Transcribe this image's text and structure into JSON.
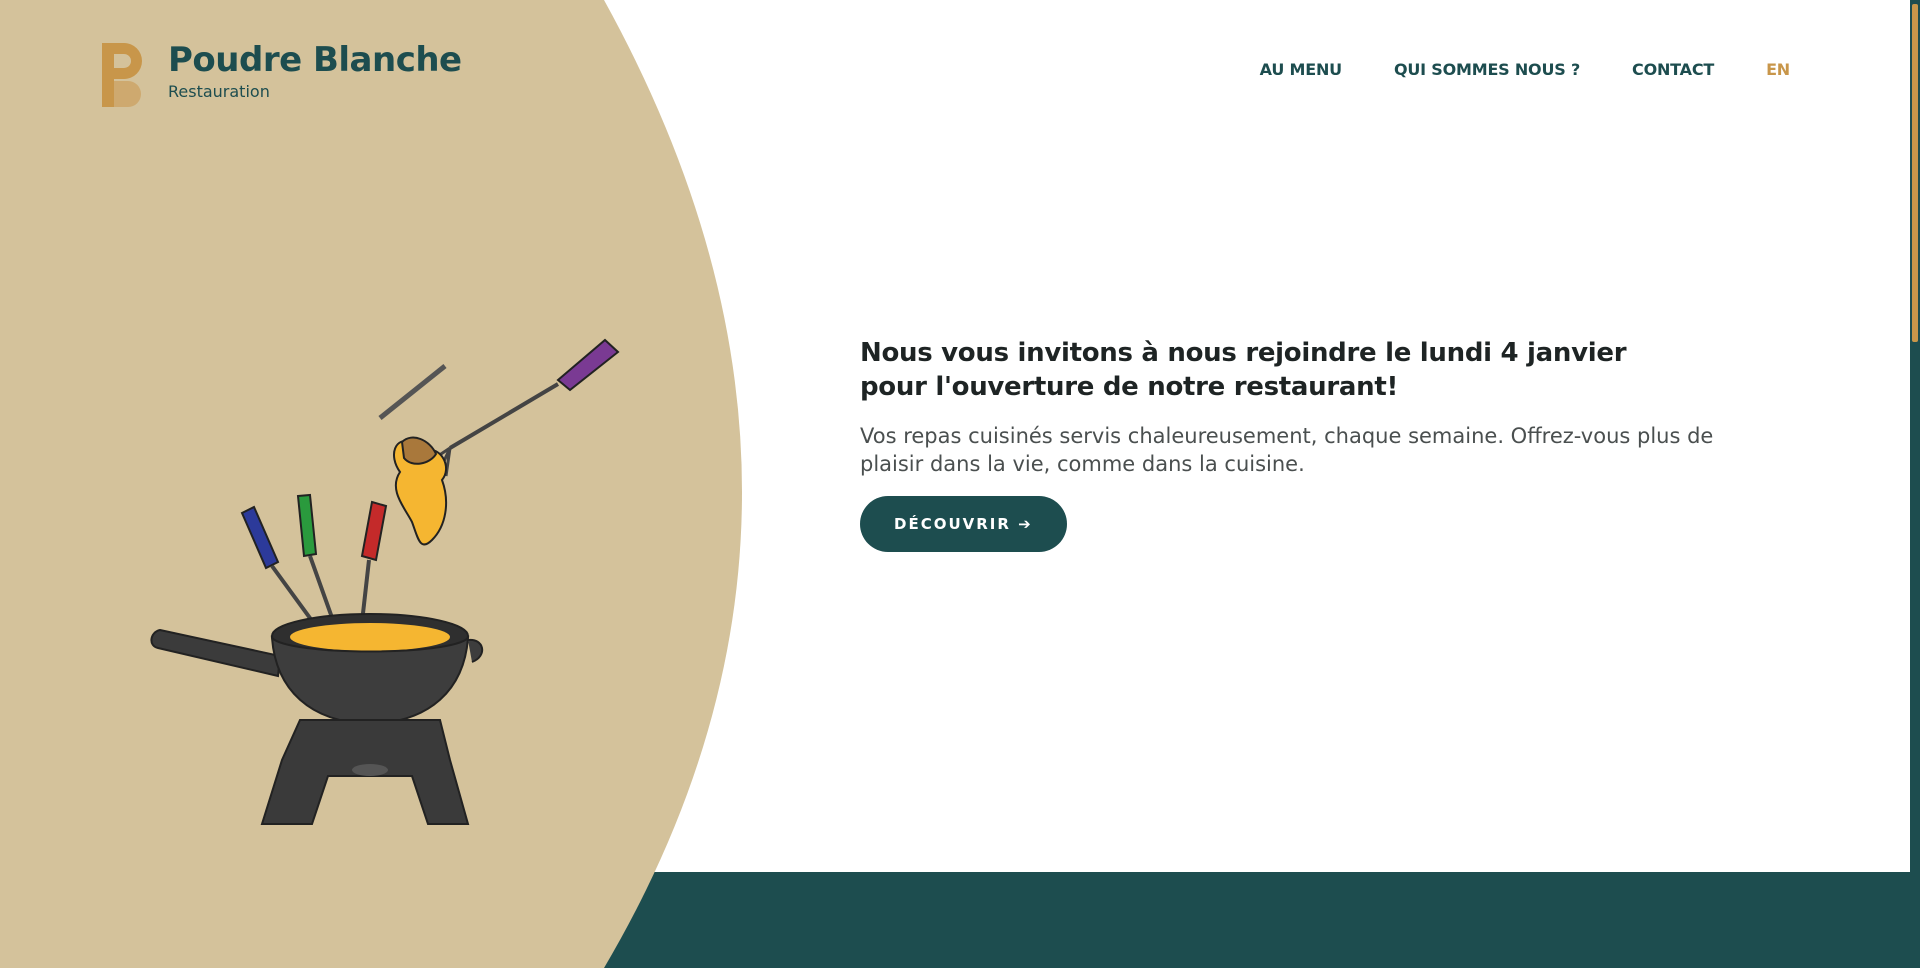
{
  "colors": {
    "teal": "#1d4d4f",
    "gold": "#c8964a",
    "sand": "#d4c29b",
    "white": "#ffffff"
  },
  "brand": {
    "name": "Poudre Blanche",
    "tagline": "Restauration",
    "logo_icon": "pb-monogram-icon"
  },
  "nav": {
    "items": [
      {
        "label": "AU MENU"
      },
      {
        "label": "QUI SOMMES NOUS ?"
      },
      {
        "label": "CONTACT"
      }
    ],
    "language": "EN"
  },
  "hero": {
    "title": "Nous vous invitons à nous rejoindre le lundi 4 janvier pour l'ouverture de notre restaurant!",
    "text": "Vos repas cuisinés servis chaleureusement, chaque semaine. Offrez-vous plus de plaisir dans la vie, comme dans la cuisine.",
    "cta_label": "DÉCOUVRIR ➔",
    "illustration": "cheese-fondue-pot-icon"
  }
}
